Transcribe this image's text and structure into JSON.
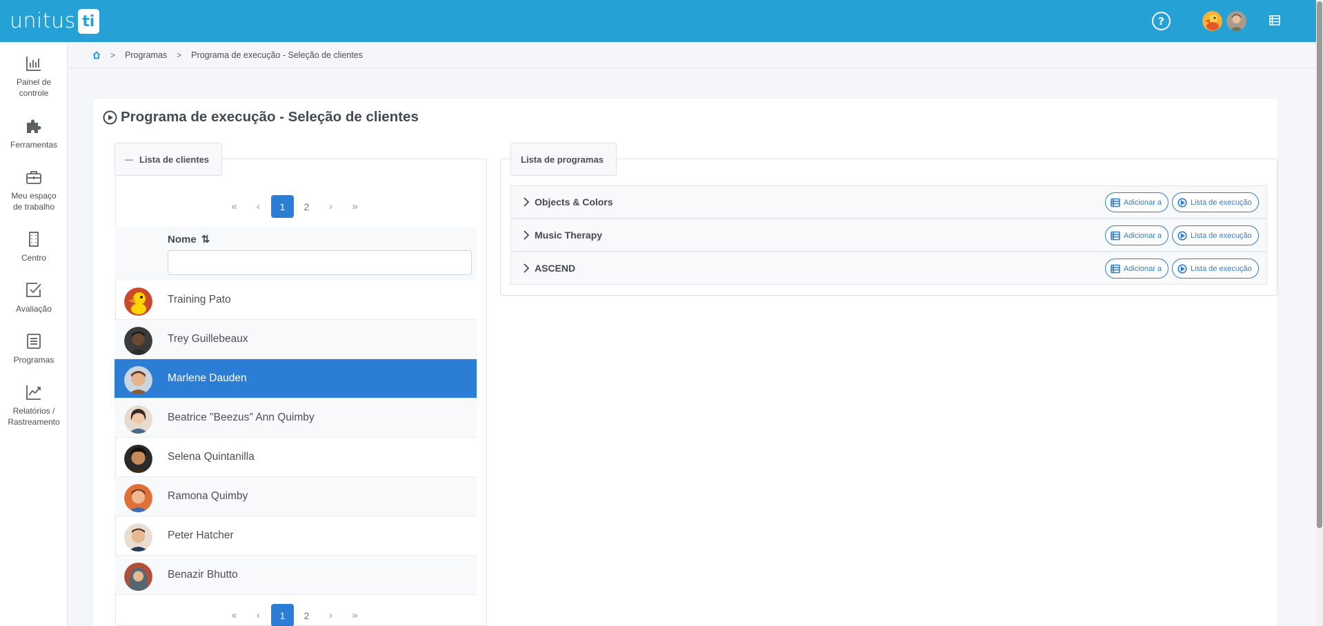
{
  "app": {
    "logo_text": "unitus",
    "logo_badge": "ti"
  },
  "header": {
    "help_glyph": "?",
    "icons": [
      "help-icon",
      "user-avatar-duck",
      "user-avatar-profile",
      "menu-list-icon"
    ]
  },
  "colors": {
    "brand": "#26a1d6",
    "primary": "#2c7dd6",
    "selected_row": "#2c7dd6"
  },
  "sidebar": {
    "items": [
      {
        "label": "Painel de controle",
        "icon": "bar-chart-icon"
      },
      {
        "label": "Ferramentas",
        "icon": "puzzle-icon"
      },
      {
        "label": "Meu espaço de trabalho",
        "icon": "briefcase-icon"
      },
      {
        "label": "Centro",
        "icon": "building-icon"
      },
      {
        "label": "Avaliação",
        "icon": "checkbox-icon"
      },
      {
        "label": "Programas",
        "icon": "document-list-icon"
      },
      {
        "label": "Relatórios / Rastreamento",
        "icon": "trend-chart-icon"
      }
    ]
  },
  "breadcrumb": {
    "items": [
      "Programas",
      "Programa de execução - Seleção de clientes"
    ]
  },
  "page": {
    "title": "Programa de execução - Seleção de clientes"
  },
  "clients_panel": {
    "legend": "Lista de clientes",
    "collapse_glyph": "—",
    "pagination": {
      "first": "«",
      "prev": "‹",
      "pages": [
        "1",
        "2"
      ],
      "current_page": "1",
      "next": "›",
      "last": "»"
    },
    "column_header": "Nome",
    "sort_glyph": "⇅",
    "filter_value": "",
    "rows": [
      {
        "name": "Training Pato",
        "selected": false
      },
      {
        "name": "Trey Guillebeaux",
        "selected": false
      },
      {
        "name": "Marlene Dauden",
        "selected": true
      },
      {
        "name": "Beatrice \"Beezus\" Ann Quimby",
        "selected": false
      },
      {
        "name": "Selena Quintanilla",
        "selected": false
      },
      {
        "name": "Ramona Quimby",
        "selected": false
      },
      {
        "name": "Peter Hatcher",
        "selected": false
      },
      {
        "name": "Benazir Bhutto",
        "selected": false
      }
    ]
  },
  "programs_panel": {
    "legend": "Lista de programas",
    "add_label": "Adicionar a",
    "run_label": "Lista de execução",
    "programs": [
      {
        "name": "Objects & Colors"
      },
      {
        "name": "Music Therapy"
      },
      {
        "name": "ASCEND"
      }
    ]
  }
}
